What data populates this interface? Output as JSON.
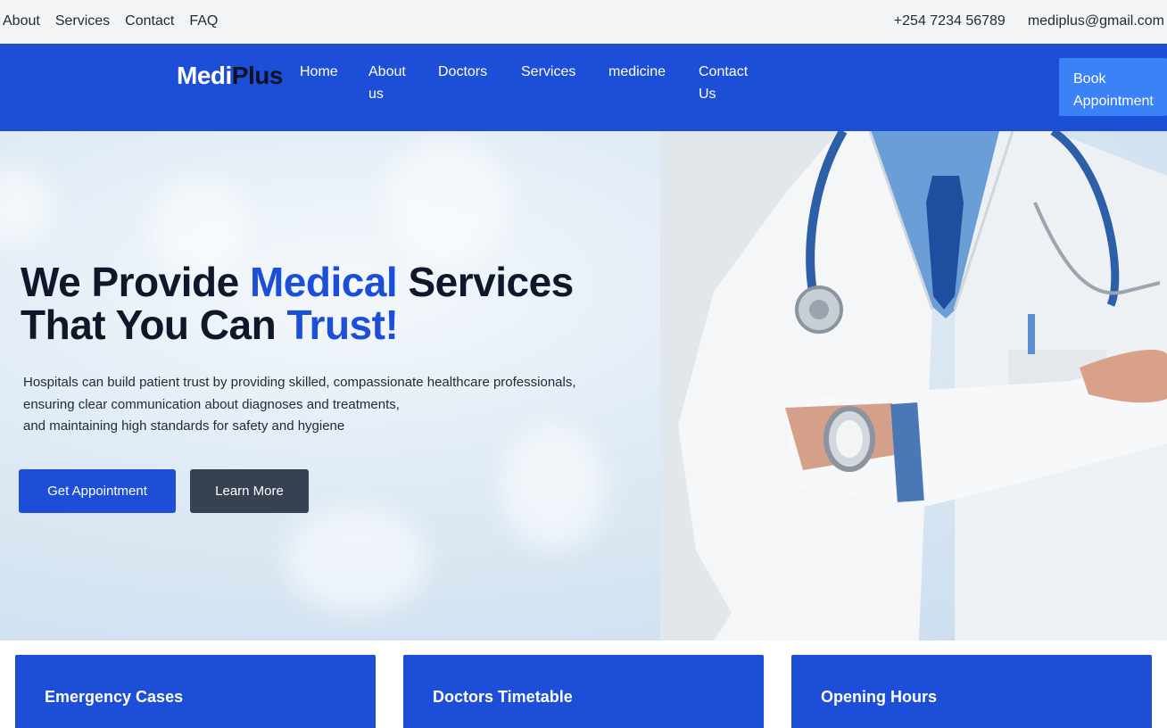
{
  "topbar": {
    "links": [
      "About",
      "Services",
      "Contact",
      "FAQ"
    ],
    "phone": "+254 7234 56789",
    "email": "mediplus@gmail.com"
  },
  "navbar": {
    "logo_part1": "Medi",
    "logo_part2": "Plus",
    "items": [
      {
        "line1": "Home",
        "line2": ""
      },
      {
        "line1": "About",
        "line2": "us"
      },
      {
        "line1": "Doctors",
        "line2": ""
      },
      {
        "line1": "Services",
        "line2": ""
      },
      {
        "line1": "medicine",
        "line2": ""
      },
      {
        "line1": "Contact",
        "line2": "Us"
      }
    ],
    "book_line1": "Book",
    "book_line2": "Appointment"
  },
  "hero": {
    "headline": {
      "w1": "We Provide ",
      "w2": "Medical",
      "w3": " Services",
      "w4": "That You Can ",
      "w5": "Trust!"
    },
    "desc": [
      "Hospitals can build patient trust by providing skilled, compassionate healthcare professionals,",
      "ensuring clear communication about diagnoses and treatments,",
      "and maintaining high standards for safety and hygiene"
    ],
    "primary_button": "Get Appointment",
    "secondary_button": "Learn More"
  },
  "cards": [
    "Emergency Cases",
    "Doctors Timetable",
    "Opening Hours"
  ],
  "colors": {
    "brand_blue": "#1d4ed8",
    "book_button": "#3b82f6",
    "secondary_button": "#374151",
    "topbar_bg": "#f3f4f6"
  },
  "icons": []
}
